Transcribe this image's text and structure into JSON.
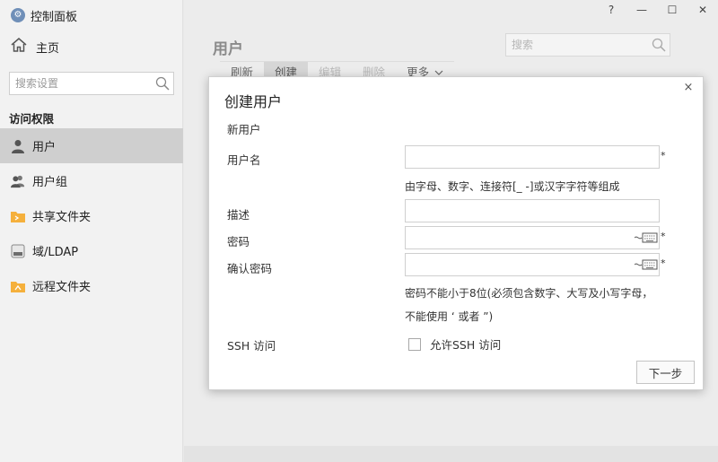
{
  "app": {
    "title": "控制面板"
  },
  "sidebar": {
    "home_label": "主页",
    "search_placeholder": "搜索设置",
    "section_title": "访问权限",
    "items": [
      {
        "label": "用户",
        "icon": "user-icon",
        "active": true
      },
      {
        "label": "用户组",
        "icon": "user-group-icon",
        "active": false
      },
      {
        "label": "共享文件夹",
        "icon": "shared-folder-icon",
        "active": false
      },
      {
        "label": "域/LDAP",
        "icon": "ldap-icon",
        "active": false
      },
      {
        "label": "远程文件夹",
        "icon": "remote-folder-icon",
        "active": false
      }
    ]
  },
  "window": {
    "help": "?",
    "minimize": "—",
    "maximize": "☐",
    "close": "✕"
  },
  "main": {
    "title": "用户",
    "search_placeholder": "搜索",
    "toolbar": {
      "refresh": "刷新",
      "create": "创建",
      "edit": "编辑",
      "delete": "删除",
      "more": "更多"
    }
  },
  "dialog": {
    "title": "创建用户",
    "subtitle": "新用户",
    "username_label": "用户名",
    "username_hint": "由字母、数字、连接符[_ -]或汉字字符等组成",
    "description_label": "描述",
    "password_label": "密码",
    "confirm_password_label": "确认密码",
    "password_hint_1": "密码不能小于8位(必须包含数字、大写及小写字母，",
    "password_hint_2": "不能使用 ‘ 或者 ”)",
    "ssh_label": "SSH 访问",
    "ssh_checkbox_label": "允许SSH 访问",
    "required_mark": "*",
    "next_button": "下一步",
    "close": "×"
  },
  "colors": {
    "active_nav": "#cfcfcf",
    "sidebar_bg": "#f2f2f2",
    "main_bg": "#ececec",
    "icon_blue": "#6f8fb8",
    "folder_orange": "#f5b03c"
  }
}
